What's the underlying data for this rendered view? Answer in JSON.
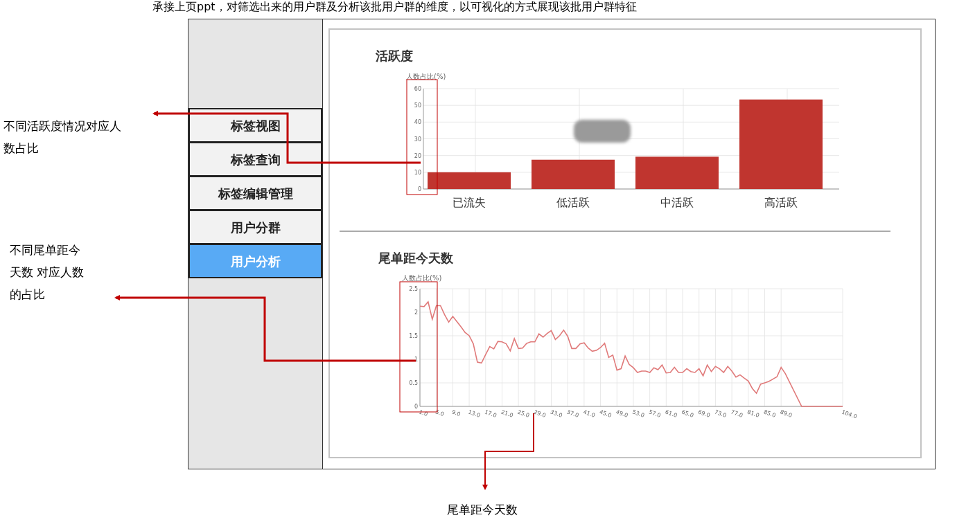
{
  "caption": "承接上页ppt，对筛选出来的用户群及分析该批用户群的维度，以可视化的方式展现该批用户群特征",
  "sidebar": {
    "items": [
      {
        "label": "标签视图",
        "selected": false
      },
      {
        "label": "标签查询",
        "selected": false
      },
      {
        "label": "标签编辑管理",
        "selected": false
      },
      {
        "label": "用户分群",
        "selected": false
      },
      {
        "label": "用户分析",
        "selected": true
      }
    ]
  },
  "activity": {
    "title": "活跃度",
    "chart_data": {
      "type": "bar",
      "ylabel": "人数占比(%)",
      "categories": [
        "已流失",
        "低活跃",
        "中活跃",
        "高活跃"
      ],
      "grid": true,
      "series": [
        {
          "color": "#c0352f",
          "values": [
            10,
            17.5,
            19.3,
            53.5
          ]
        }
      ],
      "ylim": [
        0,
        60
      ],
      "yticks": [
        0,
        10,
        20,
        30,
        40,
        50,
        60
      ]
    }
  },
  "recency": {
    "title": "尾单距今天数",
    "chart_data": {
      "type": "line",
      "ylabel": "人数占比(%)",
      "grid": true,
      "x": [
        1,
        2,
        3,
        4,
        5,
        6,
        7,
        8,
        9,
        10,
        11,
        12,
        13,
        14,
        15,
        16,
        17,
        18,
        19,
        20,
        21,
        22,
        23,
        24,
        25,
        26,
        27,
        28,
        29,
        30,
        31,
        32,
        33,
        34,
        35,
        36,
        37,
        38,
        39,
        40,
        41,
        42,
        43,
        44,
        45,
        46,
        47,
        48,
        49,
        50,
        51,
        52,
        53,
        54,
        55,
        56,
        57,
        58,
        59,
        60,
        61,
        62,
        63,
        64,
        65,
        66,
        67,
        68,
        69,
        70,
        71,
        72,
        73,
        74,
        75,
        76,
        77,
        78,
        79,
        80,
        81,
        82,
        83,
        84,
        85,
        86,
        87,
        88,
        89,
        90,
        94,
        99,
        104
      ],
      "series": [
        {
          "color": "#e07a7a",
          "values": [
            2.13,
            2.12,
            2.22,
            1.85,
            2.14,
            2.14,
            1.95,
            1.79,
            1.91,
            1.8,
            1.69,
            1.57,
            1.5,
            1.33,
            0.94,
            0.92,
            1.1,
            1.27,
            1.22,
            1.38,
            1.37,
            1.33,
            1.18,
            1.44,
            1.23,
            1.24,
            1.34,
            1.37,
            1.37,
            1.54,
            1.47,
            1.55,
            1.61,
            1.42,
            1.5,
            1.62,
            1.49,
            1.23,
            1.23,
            1.33,
            1.35,
            1.24,
            1.17,
            1.19,
            1.25,
            1.34,
            1.04,
            1.09,
            0.77,
            0.8,
            1.07,
            0.89,
            0.82,
            0.72,
            0.75,
            0.75,
            0.72,
            0.82,
            0.78,
            0.88,
            0.71,
            0.72,
            0.83,
            0.72,
            0.72,
            0.8,
            0.74,
            0.72,
            0.8,
            0.65,
            0.88,
            0.74,
            0.85,
            0.8,
            0.72,
            0.85,
            0.75,
            0.62,
            0.67,
            0.6,
            0.54,
            0.38,
            0.28,
            0.47,
            0.5,
            0.53,
            0.58,
            0.63,
            0.83,
            0.7,
            0,
            0,
            0
          ]
        }
      ],
      "xlim": [
        1,
        104
      ],
      "ylim": [
        0,
        2.5
      ],
      "yticks": [
        0,
        0.5,
        1,
        1.5,
        2,
        2.5
      ],
      "xticks": [
        {
          "value": 1,
          "label": "1.0"
        },
        {
          "value": 5,
          "label": "5.0"
        },
        {
          "value": 9,
          "label": "9.0"
        },
        {
          "value": 13,
          "label": "13.0"
        },
        {
          "value": 17,
          "label": "17.0"
        },
        {
          "value": 21,
          "label": "21.0"
        },
        {
          "value": 25,
          "label": "25.0"
        },
        {
          "value": 29,
          "label": "29.0"
        },
        {
          "value": 33,
          "label": "33.0"
        },
        {
          "value": 37,
          "label": "37.0"
        },
        {
          "value": 41,
          "label": "41.0"
        },
        {
          "value": 45,
          "label": "45.0"
        },
        {
          "value": 49,
          "label": "49.0"
        },
        {
          "value": 53,
          "label": "53.0"
        },
        {
          "value": 57,
          "label": "57.0"
        },
        {
          "value": 61,
          "label": "61.0"
        },
        {
          "value": 65,
          "label": "65.0"
        },
        {
          "value": 69,
          "label": "69.0"
        },
        {
          "value": 73,
          "label": "73.0"
        },
        {
          "value": 77,
          "label": "77.0"
        },
        {
          "value": 81,
          "label": "81.0"
        },
        {
          "value": 85,
          "label": "85.0"
        },
        {
          "value": 89,
          "label": "89.0"
        },
        {
          "value": 104,
          "label": "104.0"
        }
      ]
    }
  },
  "annotations": [
    {
      "lines": [
        "不同活跃度情况对应人",
        "数占比"
      ]
    },
    {
      "lines": [
        "不同尾单距今",
        "天数 对应人数",
        "的占比"
      ]
    },
    {
      "lines": [
        "尾单距今天数"
      ]
    }
  ]
}
